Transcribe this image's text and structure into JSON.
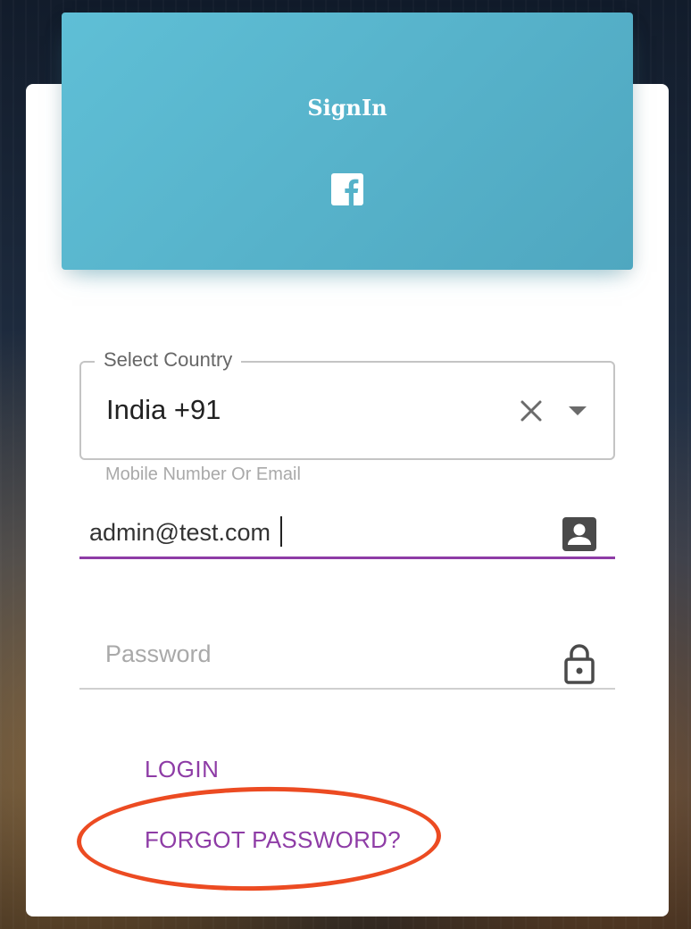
{
  "header": {
    "title": "SignIn",
    "social_icon": "facebook-icon"
  },
  "country": {
    "label": "Select Country",
    "value": "India +91"
  },
  "identifier": {
    "label": "Mobile Number Or Email",
    "value": "admin@test.com",
    "icon": "contact-card-icon"
  },
  "password": {
    "placeholder": "Password",
    "icon": "lock-icon"
  },
  "actions": {
    "login_label": "LOGIN",
    "forgot_label": "FORGOT PASSWORD?"
  },
  "colors": {
    "header": "#55b2c9",
    "accent": "#8e3ca6",
    "annotation": "#ec4b22"
  }
}
